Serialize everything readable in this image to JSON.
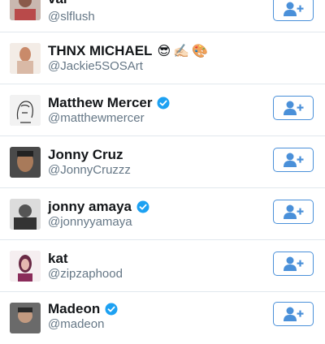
{
  "users": [
    {
      "name": "val",
      "handle": "@slflush",
      "verified": false,
      "follow": true,
      "avatar_color": "#b94a4a"
    },
    {
      "name": "THNX MICHAEL",
      "name_emoji": [
        "😎",
        "✍🏻",
        "🎨"
      ],
      "handle": "@Jackie5SOSArt",
      "verified": false,
      "follow": false,
      "avatar_color": "#d9b9a6"
    },
    {
      "name": "Matthew Mercer",
      "handle": "@matthewmercer",
      "verified": true,
      "follow": true,
      "avatar_color": "#f2f2f2"
    },
    {
      "name": "Jonny Cruz",
      "handle": "@JonnyCruzzz",
      "verified": false,
      "follow": true,
      "avatar_color": "#7a5a44"
    },
    {
      "name": "jonny amaya",
      "handle": "@jonnyyamaya",
      "verified": true,
      "follow": true,
      "avatar_color": "#555555"
    },
    {
      "name": "kat",
      "handle": "@zipzaphood",
      "verified": false,
      "follow": true,
      "avatar_color": "#8a2c5a"
    },
    {
      "name": "Madeon",
      "handle": "@madeon",
      "verified": true,
      "follow": true,
      "avatar_color": "#3b3b3b"
    }
  ],
  "colors": {
    "accent": "#4a90d9",
    "verified": "#1da1f2",
    "divider": "#e1e8ed"
  },
  "icons": {
    "follow": "add-user-icon",
    "verified": "verified-badge-icon"
  }
}
